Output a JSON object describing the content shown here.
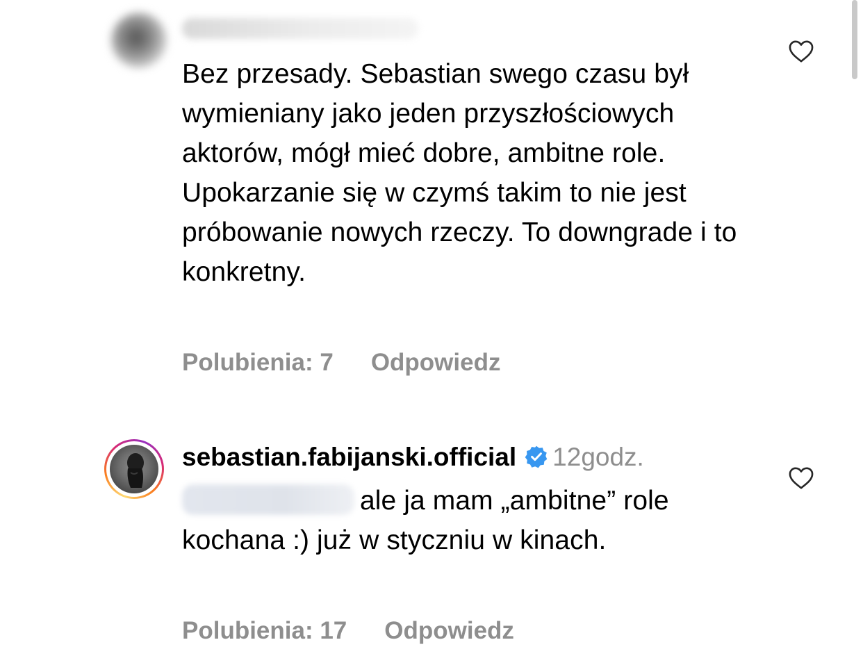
{
  "comments": [
    {
      "username": "",
      "time": "",
      "body": "Bez przesady. Sebastian swego czasu był wymieniany jako jeden przyszłościowych aktorów, mógł mieć dobre, ambitne role. Upokarzanie się w czymś takim to nie jest próbowanie nowych rzeczy. To downgrade i to konkretny.",
      "likes_label": "Polubienia: 7",
      "reply_label": "Odpowiedz",
      "liked": false
    },
    {
      "username": "sebastian.fabijanski.official",
      "verified": true,
      "time": "12godz.",
      "mention": "",
      "body": "ale ja mam „ambitne” role kochana :) już w styczniu w kinach.",
      "likes_label": "Polubienia: 17",
      "reply_label": "Odpowiedz",
      "liked": false
    }
  ],
  "colors": {
    "text": "#000000",
    "secondary_text": "#8e8e8e",
    "verified_badge": "#3897f0",
    "story_ring": [
      "#feda75",
      "#fa7e1e",
      "#d62976",
      "#962fbf"
    ]
  },
  "icons": {
    "like": "heart-outline-icon",
    "verified": "verified-badge-icon"
  }
}
